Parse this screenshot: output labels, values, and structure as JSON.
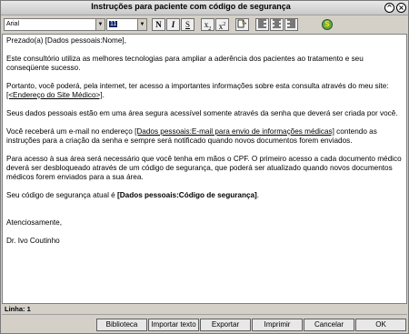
{
  "window": {
    "title": "Instruções para paciente com código de segurança"
  },
  "toolbar": {
    "font": "Arial",
    "size": "11",
    "bold": "N",
    "italic": "I",
    "underline": "S",
    "subscript_base": "x",
    "subscript": "2",
    "superscript_base": "x",
    "superscript": "2"
  },
  "editor": {
    "greeting_prefix": "Prezado(a) ",
    "greeting_field": "[Dados pessoais:Nome]",
    "greeting_suffix": ",",
    "p1": "Este consultório utiliza as melhores tecnologias para ampliar a aderência dos pacientes ao tratamento e seu conseqüente sucesso.",
    "p2_prefix": "Portanto, você poderá, pela internet, ter acesso a importantes informações sobre esta consulta através do meu site: ",
    "p2_field": "[<Endereço do Site Médico>]",
    "p2_suffix": ".",
    "p3": "Seus dados pessoais estão em uma área segura acessível somente através da senha que deverá ser criada por você.",
    "p4_prefix": "Você receberá um e-mail no endereço ",
    "p4_field": "[Dados pessoais:E-mail para envio de informações médicas]",
    "p4_suffix": " contendo as instruções para a criação da senha e sempre será notificado quando novos documentos forem enviados.",
    "p5": "Para acesso à sua área será necessário que você tenha em mãos o CPF. O primeiro acesso a cada documento médico deverá ser desbloqueado através de um código de segurança, que poderá ser atualizado quando novos documentos médicos forem enviados para a sua área.",
    "p6_prefix": "Seu código de segurança atual é ",
    "p6_field": "[Dados pessoais:Código de segurança]",
    "p6_suffix": ".",
    "closing": "Atenciosamente,",
    "signature": "Dr. Ivo Coutinho"
  },
  "status": {
    "line": "Linha: 1"
  },
  "buttons": {
    "library": "Biblioteca",
    "import": "Importar texto",
    "export": "Exportar",
    "print": "Imprimir",
    "cancel": "Cancelar",
    "ok": "OK"
  }
}
